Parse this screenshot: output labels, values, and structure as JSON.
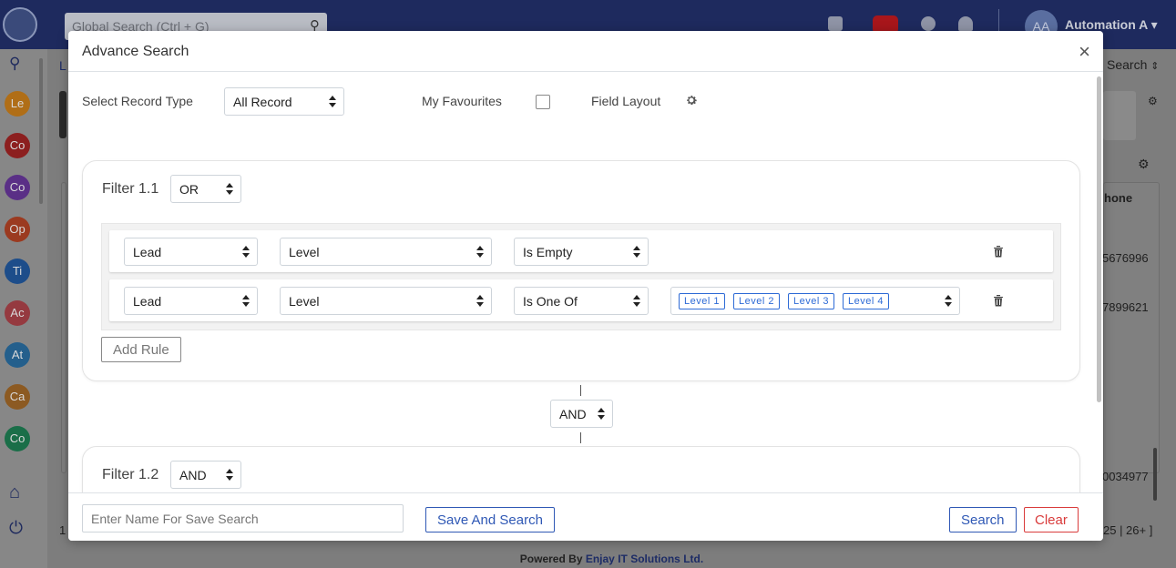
{
  "app": {
    "global_search_placeholder": "Global Search (Ctrl + G)",
    "user_initials": "AA",
    "user_name": "Automation A",
    "user_caret": "▾",
    "breadcrumb_fragment": "L",
    "search_dropdown_label": "Search",
    "phone_header_fragment": "hone",
    "phone_values": [
      "5676996",
      "7899621",
      "0034977"
    ],
    "pagination_left": "1",
    "pagination_right": "25 | 26+ ]",
    "footer_prefix": "Powered By",
    "footer_brand": "Enjay IT Solutions Ltd."
  },
  "sidebar": {
    "items": [
      {
        "label": "Le",
        "color": "#b06e17"
      },
      {
        "label": "Co",
        "color": "#8c1f1f"
      },
      {
        "label": "Co",
        "color": "#5a2f86"
      },
      {
        "label": "Op",
        "color": "#9b3a20"
      },
      {
        "label": "Ti",
        "color": "#1d4d8a"
      },
      {
        "label": "Ac",
        "color": "#953a40"
      },
      {
        "label": "At",
        "color": "#245f8c"
      },
      {
        "label": "Ca",
        "color": "#8c5a22"
      },
      {
        "label": "Co",
        "color": "#1a6e48"
      }
    ],
    "icons": [
      "search-icon",
      "home-icon",
      "power-icon"
    ]
  },
  "modal": {
    "title": "Advance Search",
    "close_label": "×",
    "record_type_label": "Select Record Type",
    "record_type_value": "All Record",
    "favourites_label": "My Favourites",
    "field_layout_label": "Field Layout",
    "filters": [
      {
        "title": "Filter 1.1",
        "operator": "OR",
        "rules": [
          {
            "module": "Lead",
            "field": "Level",
            "condition": "Is Empty",
            "values": []
          },
          {
            "module": "Lead",
            "field": "Level",
            "condition": "Is One Of",
            "values": [
              "Level 1",
              "Level 2",
              "Level 3",
              "Level 4"
            ]
          }
        ],
        "add_rule_label": "Add Rule"
      },
      {
        "title": "Filter 1.2",
        "operator": "AND"
      }
    ],
    "group_connector": "AND",
    "footer": {
      "save_name_placeholder": "Enter Name For Save Search",
      "save_and_search_label": "Save And Search",
      "search_label": "Search",
      "clear_label": "Clear"
    }
  },
  "colors": {
    "topbar": "#1e2a5e",
    "primary_blue": "#2f58b5",
    "clear_red": "#d93b3b",
    "tag_blue": "#2e6bd6"
  }
}
